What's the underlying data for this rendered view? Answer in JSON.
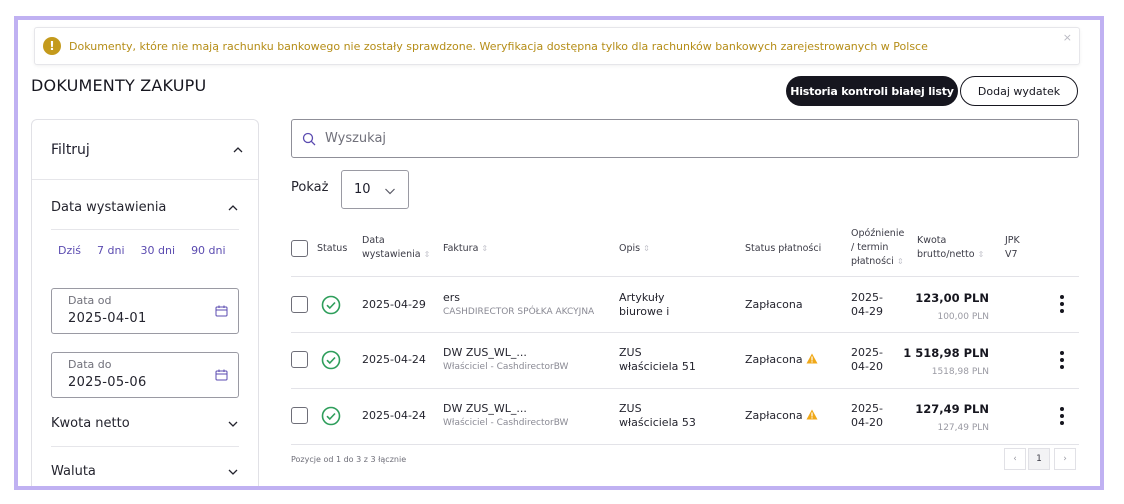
{
  "alert": {
    "icon": "exclamation-icon",
    "text": "Dokumenty, które nie mają rachunku bankowego nie zostały sprawdzone. Weryfikacja dostępna tylko dla rachunków bankowych zarejestrowanych w Polsce",
    "close": "×"
  },
  "page": {
    "title": "DOKUMENTY ZAKUPU",
    "btn_history": "Historia kontroli białej listy",
    "btn_add": "Dodaj wydatek"
  },
  "filters": {
    "title": "Filtruj",
    "date_section": "Data wystawienia",
    "quick": [
      "Dziś",
      "7 dni",
      "30 dni",
      "90 dni"
    ],
    "date_from_label": "Data od",
    "date_from_value": "2025-04-01",
    "date_to_label": "Data do",
    "date_to_value": "2025-05-06",
    "net_amount": "Kwota netto",
    "currency": "Waluta"
  },
  "search": {
    "placeholder": "Wyszukaj"
  },
  "show": {
    "label": "Pokaż",
    "value": "10"
  },
  "table": {
    "headers": {
      "status": "Status",
      "date_l1": "Data",
      "date_l2": "wystawienia",
      "invoice": "Faktura",
      "desc": "Opis",
      "payment": "Status płatności",
      "delay_l1": "Opóźnienie",
      "delay_l2": "/ termin",
      "delay_l3": "płatności",
      "amount_l1": "Kwota",
      "amount_l2": "brutto/netto",
      "jpk_l1": "JPK",
      "jpk_l2": "V7"
    },
    "rows": [
      {
        "date": "2025-04-29",
        "invoice": "ers",
        "company": "CASHDIRECTOR SPÓŁKA AKCYJNA",
        "desc_l1": "Artykuły",
        "desc_l2": "biurowe i",
        "payment": "Zapłacona",
        "warning": false,
        "due_l1": "2025-",
        "due_l2": "04-29",
        "gross": "123,00 PLN",
        "net": "100,00 PLN"
      },
      {
        "date": "2025-04-24",
        "invoice": "DW ZUS_WL_...",
        "company": "Właściciel - CashdirectorBW",
        "desc_l1": "ZUS",
        "desc_l2": "właściciela 51",
        "payment": "Zapłacona",
        "warning": true,
        "due_l1": "2025-",
        "due_l2": "04-20",
        "gross": "1 518,98 PLN",
        "net": "1518,98 PLN"
      },
      {
        "date": "2025-04-24",
        "invoice": "DW ZUS_WL_...",
        "company": "Właściciel - CashdirectorBW",
        "desc_l1": "ZUS",
        "desc_l2": "właściciela 53",
        "payment": "Zapłacona",
        "warning": true,
        "due_l1": "2025-",
        "due_l2": "04-20",
        "gross": "127,49 PLN",
        "net": "127,49 PLN"
      }
    ]
  },
  "footer": {
    "summary": "Pozycje od 1 do 3 z 3 łącznie",
    "prev": "‹",
    "page": "1",
    "next": "›"
  },
  "colors": {
    "frame": "#c0b1f2",
    "accent": "#5b4bb0",
    "success": "#2e9e5b",
    "warning": "#f0a818",
    "alert_text": "#b58d17"
  }
}
